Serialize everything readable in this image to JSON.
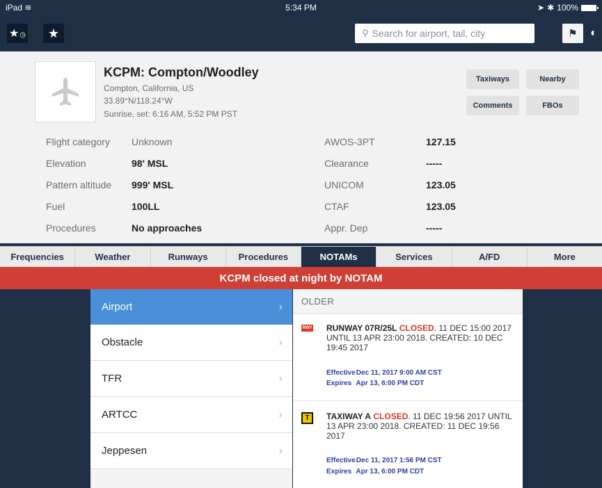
{
  "status_bar": {
    "device": "iPad",
    "time": "5:34 PM",
    "battery": "100%"
  },
  "nav": {
    "search_placeholder": "Search for airport, tail, city",
    "icons": [
      "recent-favorites-icon",
      "star-icon",
      "map-pin-icon",
      "settings-icon"
    ]
  },
  "airport": {
    "title": "KCPM: Compton/Woodley",
    "location": "Compton, California, US",
    "coords": "33.89°N/118.24°W",
    "sun": "Sunrise, set: 6:16 AM, 5:52 PM PST",
    "buttons": [
      "Taxiways",
      "Nearby",
      "Comments",
      "FBOs"
    ],
    "info_left": [
      {
        "label": "Flight category",
        "value": "Unknown"
      },
      {
        "label": "Elevation",
        "value": "98' MSL"
      },
      {
        "label": "Pattern altitude",
        "value": "999' MSL"
      },
      {
        "label": "Fuel",
        "value": "100LL"
      },
      {
        "label": "Procedures",
        "value": "No approaches"
      }
    ],
    "info_right": [
      {
        "label": "AWOS-3PT",
        "value": "127.15"
      },
      {
        "label": "Clearance",
        "value": "-----"
      },
      {
        "label": "UNICOM",
        "value": "123.05"
      },
      {
        "label": "CTAF",
        "value": "123.05"
      },
      {
        "label": "Appr. Dep",
        "value": "-----"
      }
    ]
  },
  "tabs": [
    "Frequencies",
    "Weather",
    "Runways",
    "Procedures",
    "NOTAMs",
    "Services",
    "A/FD",
    "More"
  ],
  "active_tab": "NOTAMs",
  "alert": "KCPM closed at night by NOTAM",
  "categories": [
    "Airport",
    "Obstacle",
    "TFR",
    "ARTCC",
    "Jeppesen"
  ],
  "active_category": "Airport",
  "notam_section": "OLDER",
  "notams": [
    {
      "icon": "RWY",
      "kw": "RUNWAY 07R/25L",
      "closed": "CLOSED",
      "rest": ". 11 DEC 15:00 2017 UNTIL 13 APR 23:00 2018. CREATED: 10 DEC 19:45 2017",
      "effective_label": "Effective",
      "effective": "Dec 11, 2017 9:00 AM CST",
      "expires_label": "Expires",
      "expires": "Apr 13, 6:00 PM CDT"
    },
    {
      "icon": "T",
      "kw": "TAXIWAY A",
      "closed": "CLOSED",
      "rest": ". 11 DEC 19:56 2017 UNTIL 13 APR 23:00 2018. CREATED: 11 DEC 19:56 2017",
      "effective_label": "Effective",
      "effective": "Dec 11, 2017 1:56 PM CST",
      "expires_label": "Expires",
      "expires": "Apr 13, 6:00 PM CDT"
    }
  ],
  "colors": {
    "navy": "#1f3046",
    "accent_blue": "#4a90d9",
    "alert_red": "#cf3f36",
    "closed_red": "#d93a2b",
    "link_blue": "#2c3fa6"
  }
}
